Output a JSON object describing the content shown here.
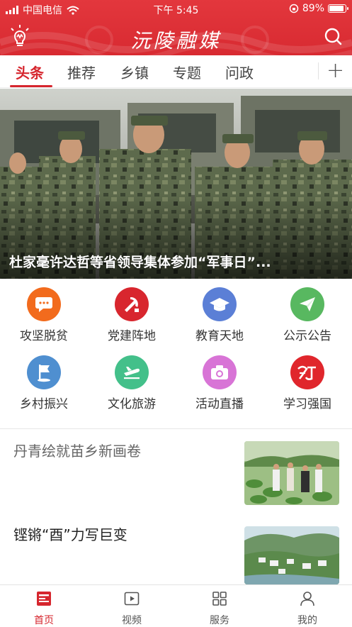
{
  "status_bar": {
    "carrier": "中国电信",
    "time": "下午 5:45",
    "battery": "89%"
  },
  "header": {
    "title": "沅陵融媒"
  },
  "tabs": [
    {
      "label": "头条",
      "active": true
    },
    {
      "label": "推荐",
      "active": false
    },
    {
      "label": "乡镇",
      "active": false
    },
    {
      "label": "专题",
      "active": false
    },
    {
      "label": "问政",
      "active": false
    }
  ],
  "banner": {
    "caption": "杜家毫许达哲等省领导集体参加“军事日”..."
  },
  "grid": [
    {
      "label": "攻坚脱贫",
      "icon": "message-icon",
      "color": "#f26b1d"
    },
    {
      "label": "党建阵地",
      "icon": "party-emblem-icon",
      "color": "#d8262e"
    },
    {
      "label": "教育天地",
      "icon": "graduation-cap-icon",
      "color": "#5b7fd6"
    },
    {
      "label": "公示公告",
      "icon": "paper-plane-icon",
      "color": "#58b860"
    },
    {
      "label": "乡村振兴",
      "icon": "flag-icon",
      "color": "#4f8fd0"
    },
    {
      "label": "文化旅游",
      "icon": "airplane-icon",
      "color": "#43c08a"
    },
    {
      "label": "活动直播",
      "icon": "camera-icon",
      "color": "#d874d6"
    },
    {
      "label": "学习强国",
      "icon": "xuexi-logo-icon",
      "color": "#e0262c"
    }
  ],
  "news": [
    {
      "title": "丹青绘就苗乡新画卷"
    },
    {
      "title": "铿锵“酉”力写巨变"
    }
  ],
  "bottom_nav": [
    {
      "label": "首页",
      "icon": "home-icon",
      "active": true
    },
    {
      "label": "视频",
      "icon": "video-icon",
      "active": false
    },
    {
      "label": "服务",
      "icon": "grid-icon",
      "active": false
    },
    {
      "label": "我的",
      "icon": "user-icon",
      "active": false
    }
  ],
  "colors": {
    "brand": "#d8262e",
    "inactive_text": "#555555"
  }
}
